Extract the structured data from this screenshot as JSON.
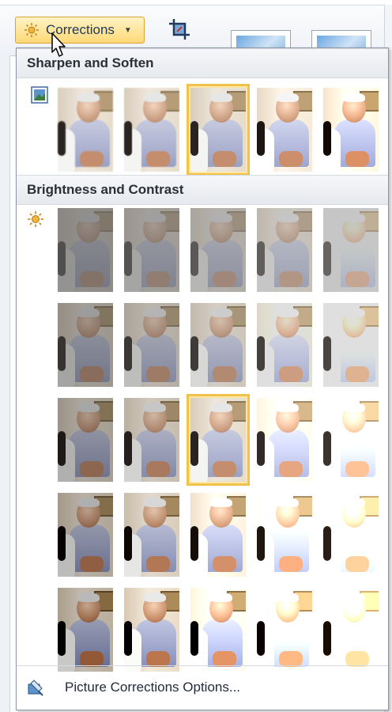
{
  "ribbon": {
    "corrections_label": "Corrections",
    "corrections_icon": "sun-icon",
    "crop_icon": "crop-icon"
  },
  "gallery": {
    "sharpen_title": "Sharpen and Soften",
    "sharpen_icon": "sharpen-soften-icon",
    "sharpen_selected_index": 2,
    "brightness_title": "Brightness and Contrast",
    "brightness_icon": "sun-icon",
    "brightness_selected": {
      "row": 2,
      "col": 2
    },
    "footer_label": "Picture Corrections Options...",
    "footer_icon": "picture-format-icon",
    "accent_color": "#f0c24b"
  }
}
